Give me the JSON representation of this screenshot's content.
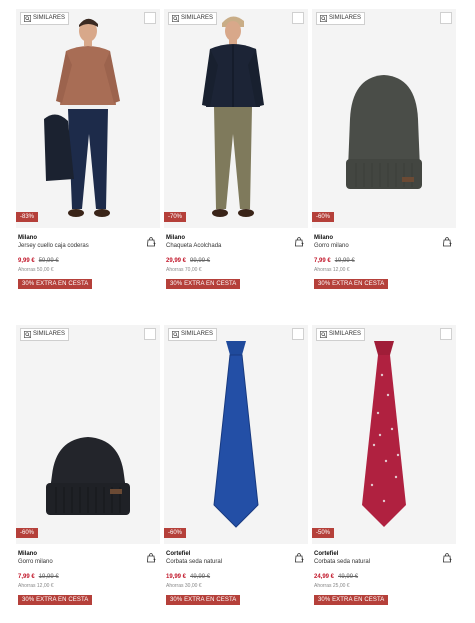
{
  "similares_label": "SIMILARES",
  "products": [
    {
      "discount": "-83%",
      "brand": "Milano",
      "name": "Jersey cuello caja coderas",
      "price": "9,99 €",
      "old_price": "59,99 €",
      "ahorras": "Ahorras 50,00 €",
      "promo": "30% EXTRA EN CESTA",
      "icon": "sweater-man-image"
    },
    {
      "discount": "-70%",
      "brand": "Milano",
      "name": "Chaqueta Acolchada",
      "price": "29,99 €",
      "old_price": "99,99 €",
      "ahorras": "Ahorras 70,00 €",
      "promo": "30% EXTRA EN CESTA",
      "icon": "jacket-man-image"
    },
    {
      "discount": "-60%",
      "brand": "Milano",
      "name": "Gorro milano",
      "price": "7,99 €",
      "old_price": "19,99 €",
      "ahorras": "Ahorras 12,00 €",
      "promo": "30% EXTRA EN CESTA",
      "icon": "grey-beanie-image"
    },
    {
      "discount": "-60%",
      "brand": "Milano",
      "name": "Gorro milano",
      "price": "7,99 €",
      "old_price": "19,99 €",
      "ahorras": "Ahorras 12,00 €",
      "promo": "30% EXTRA EN CESTA",
      "icon": "black-beanie-image"
    },
    {
      "discount": "-60%",
      "brand": "Cortefiel",
      "name": "Corbata seda natural",
      "price": "19,99 €",
      "old_price": "49,99 €",
      "ahorras": "Ahorras 30,00 €",
      "promo": "30% EXTRA EN CESTA",
      "icon": "blue-tie-image"
    },
    {
      "discount": "-50%",
      "brand": "Cortefiel",
      "name": "Corbata seda natural",
      "price": "24,99 €",
      "old_price": "49,99 €",
      "ahorras": "Ahorras 25,00 €",
      "promo": "30% EXTRA EN CESTA",
      "icon": "red-tie-image"
    }
  ],
  "colors": {
    "discount_bg": "#b5403a",
    "price_red": "#c2182b"
  }
}
